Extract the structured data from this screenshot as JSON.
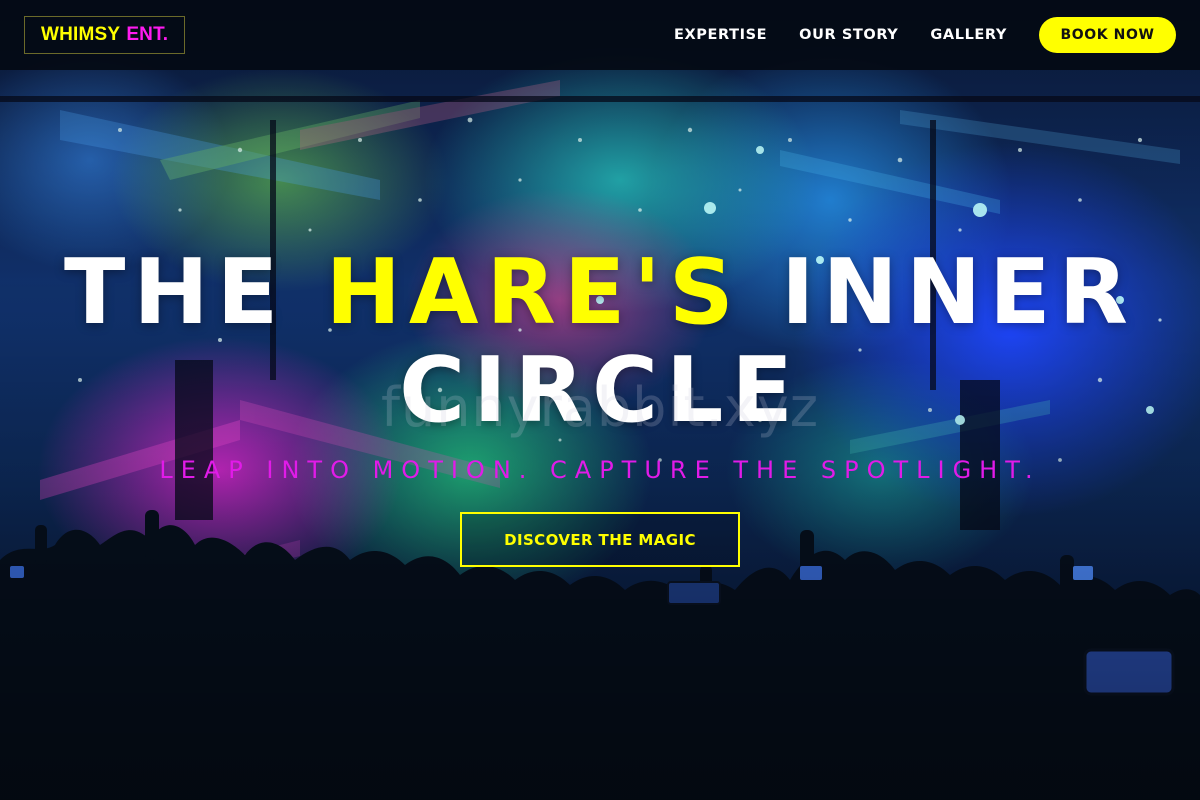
{
  "nav": {
    "logo_part1": "WHIMSY",
    "logo_part2": "ENT.",
    "links": [
      {
        "label": "EXPERTISE"
      },
      {
        "label": "OUR STORY"
      },
      {
        "label": "GALLERY"
      }
    ],
    "book_button": "BOOK NOW"
  },
  "hero": {
    "title_part1": "THE",
    "title_highlight": "HARE'S",
    "title_part2": "INNER",
    "title_line2": "CIRCLE",
    "watermark": "funnyrabbit.xyz",
    "tagline": "LEAP INTO MOTION. CAPTURE THE SPOTLIGHT.",
    "cta_label": "DISCOVER THE MAGIC"
  },
  "colors": {
    "accent_yellow": "#ffff00",
    "accent_magenta": "#e11be8",
    "nav_background": "#040a14",
    "text_white": "#ffffff"
  }
}
